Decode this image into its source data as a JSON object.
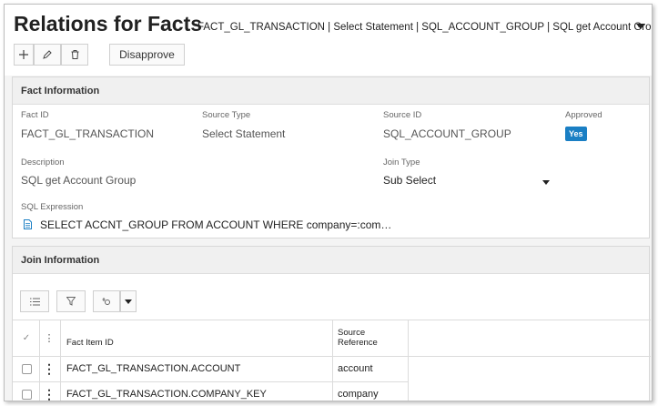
{
  "header": {
    "title": "Relations for Facts",
    "breadcrumb": "FACT_GL_TRANSACTION | Select Statement | SQL_ACCOUNT_GROUP | SQL get Account Group",
    "toolbar": {
      "add_icon": "plus-icon",
      "edit_icon": "pencil-icon",
      "delete_icon": "trash-icon",
      "disapprove_label": "Disapprove"
    }
  },
  "fact_information": {
    "title": "Fact Information",
    "fact_id": {
      "label": "Fact ID",
      "value": "FACT_GL_TRANSACTION"
    },
    "source_type": {
      "label": "Source Type",
      "value": "Select Statement"
    },
    "source_id": {
      "label": "Source ID",
      "value": "SQL_ACCOUNT_GROUP"
    },
    "approved": {
      "label": "Approved",
      "value": "Yes",
      "color": "#1a7fc4"
    },
    "description": {
      "label": "Description",
      "value": "SQL get Account Group"
    },
    "join_type": {
      "label": "Join Type",
      "value": "Sub Select"
    },
    "sql_expression": {
      "label": "SQL Expression",
      "value": "SELECT ACCNT_GROUP FROM ACCOUNT WHERE company=:com…",
      "icon": "document-icon"
    }
  },
  "join_information": {
    "title": "Join Information",
    "toolbar_icons": [
      "list-icon",
      "filter-icon",
      "settings-icon",
      "dropdown-icon"
    ],
    "columns": {
      "select_all": "✓",
      "menu": "⋮",
      "fact_item_id": "Fact Item ID",
      "source_reference_line1": "Source",
      "source_reference_line2": "Reference"
    },
    "rows": [
      {
        "fact_item_id": "FACT_GL_TRANSACTION.ACCOUNT",
        "source_reference": "account"
      },
      {
        "fact_item_id": "FACT_GL_TRANSACTION.COMPANY_KEY",
        "source_reference": "company"
      }
    ]
  }
}
